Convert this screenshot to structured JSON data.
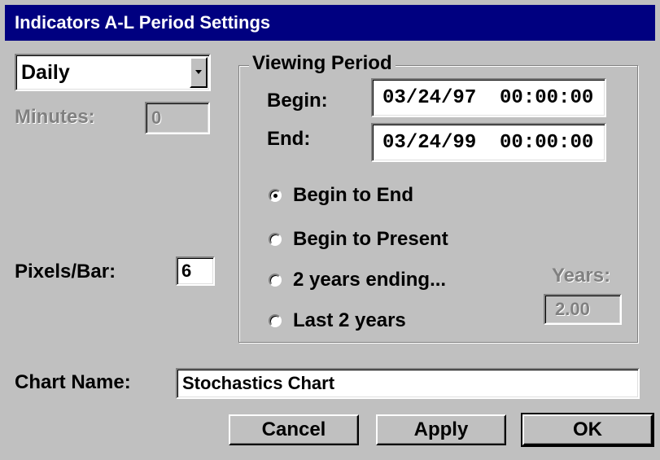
{
  "window": {
    "title": "Indicators A-L Period Settings"
  },
  "period_type": {
    "selected": "Daily"
  },
  "minutes": {
    "label": "Minutes:",
    "value": "0"
  },
  "pixels_per_bar": {
    "label": "Pixels/Bar:",
    "value": "6"
  },
  "viewing_period": {
    "label": "Viewing Period",
    "begin_label": "Begin:",
    "begin_value": "03/24/97  00:00:00",
    "end_label": "End:",
    "end_value": "03/24/99  00:00:00",
    "options": [
      {
        "label": "Begin to End",
        "checked": true
      },
      {
        "label": "Begin to Present",
        "checked": false
      },
      {
        "label": "2 years ending...",
        "checked": false
      },
      {
        "label": "Last 2 years",
        "checked": false
      }
    ],
    "years_label": "Years:",
    "years_value": "2.00"
  },
  "chart_name": {
    "label": "Chart Name:",
    "value": "Stochastics Chart"
  },
  "buttons": {
    "cancel": "Cancel",
    "apply": "Apply",
    "ok": "OK"
  },
  "colors": {
    "titlebar": "#000080",
    "face": "#c0c0c0",
    "disabled_text": "#808080"
  }
}
